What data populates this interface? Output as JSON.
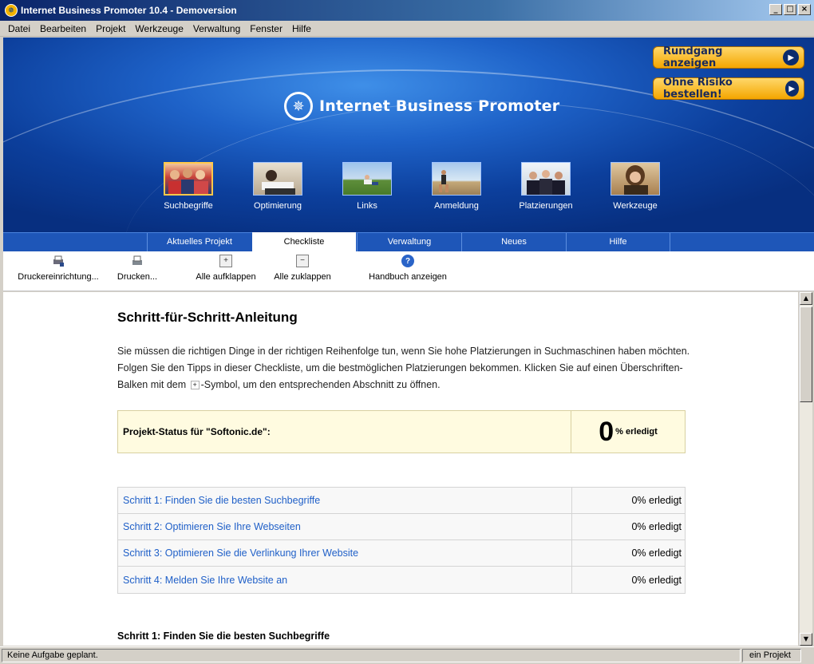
{
  "window": {
    "title": "Internet Business Promoter 10.4 - Demoversion",
    "controls": [
      "_",
      "□",
      "×"
    ]
  },
  "menu": [
    "Datei",
    "Bearbeiten",
    "Projekt",
    "Werkzeuge",
    "Verwaltung",
    "Fenster",
    "Hilfe"
  ],
  "banner": {
    "brand": "Internet Business Promoter",
    "tour_button": "Rundgang anzeigen",
    "order_button": "Ohne Risiko bestellen!",
    "nav": [
      {
        "label": "Suchbegriffe",
        "icon": "people-photo-icon",
        "active": true
      },
      {
        "label": "Optimierung",
        "icon": "reading-photo-icon",
        "active": false
      },
      {
        "label": "Links",
        "icon": "field-photo-icon",
        "active": false
      },
      {
        "label": "Anmeldung",
        "icon": "runner-photo-icon",
        "active": false
      },
      {
        "label": "Platzierungen",
        "icon": "team-photo-icon",
        "active": false
      },
      {
        "label": "Werkzeuge",
        "icon": "woman-photo-icon",
        "active": false
      }
    ]
  },
  "tabs": [
    {
      "label": "Aktuelles Projekt",
      "active": false
    },
    {
      "label": "Checkliste",
      "active": true
    },
    {
      "label": "Verwaltung",
      "active": false
    },
    {
      "label": "Neues",
      "active": false
    },
    {
      "label": "Hilfe",
      "active": false
    }
  ],
  "toolbar": {
    "printer_setup": "Druckereinrichtung...",
    "print": "Drucken...",
    "expand_all": "Alle aufklappen",
    "collapse_all": "Alle zuklappen",
    "manual": "Handbuch anzeigen",
    "expand_symbol": "+",
    "collapse_symbol": "−",
    "help_symbol": "?"
  },
  "content": {
    "heading": "Schritt-für-Schritt-Anleitung",
    "intro_part1": "Sie müssen die richtigen Dinge in der richtigen Reihenfolge tun, wenn Sie hohe Platzierungen in Suchmaschinen haben möchten. Folgen Sie den Tipps in dieser Checkliste, um die bestmöglichen Platzierungen bekommen. Klicken Sie auf einen Überschriften-Balken mit dem",
    "intro_symbol": "+",
    "intro_part2": "-Symbol, um den entsprechenden Abschnitt zu öffnen.",
    "status_label": "Projekt-Status für \"Softonic.de\":",
    "status_value": "0",
    "status_suffix": "% erledigt",
    "steps": [
      {
        "title": "Schritt 1: Finden Sie die besten Suchbegriffe",
        "status": "0% erledigt"
      },
      {
        "title": "Schritt 2: Optimieren Sie Ihre Webseiten",
        "status": "0% erledigt"
      },
      {
        "title": "Schritt 3: Optimieren Sie die Verlinkung Ihrer Website",
        "status": "0% erledigt"
      },
      {
        "title": "Schritt 4: Melden Sie Ihre Website an",
        "status": "0% erledigt"
      }
    ],
    "section1_heading": "Schritt 1: Finden Sie die besten Suchbegriffe"
  },
  "statusbar": {
    "left": "Keine Aufgabe geplant.",
    "right": "ein Projekt"
  },
  "colors": {
    "banner_blue": "#1e62c8",
    "accent_orange": "#f4a500",
    "link_blue": "#2060c8",
    "status_bg": "#fffbe0"
  }
}
